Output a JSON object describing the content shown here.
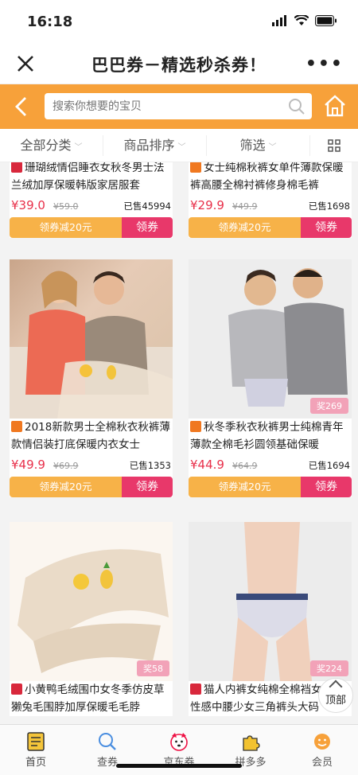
{
  "status_bar": {
    "time": "16:18"
  },
  "nav": {
    "title": "巴巴券－精选秒杀券！",
    "more": "•••"
  },
  "search": {
    "placeholder": "搜索你想要的宝贝"
  },
  "filters": [
    "全部分类",
    "商品排序",
    "筛选"
  ],
  "colors": {
    "brand_orange": "#f7a13a",
    "price_red": "#e8304a",
    "coupon_orange": "#f7b248",
    "get_pink": "#e8386a"
  },
  "products": [
    {
      "title": "珊瑚绒情侣睡衣女秋冬男士法兰绒加厚保暖韩版家居服套",
      "price": "¥39.0",
      "orig": "¥59.0",
      "sold": "已售45994",
      "coupon": "领券减20元",
      "get": "领券",
      "badge": ""
    },
    {
      "title": "女士纯棉秋裤女单件薄款保暖裤高腰全棉衬裤修身棉毛裤",
      "price": "¥29.9",
      "orig": "¥49.9",
      "sold": "已售1698",
      "coupon": "领券减20元",
      "get": "领券",
      "badge": ""
    },
    {
      "title": "2018新款男士全棉秋衣秋裤薄款情侣装打底保暖内衣女士",
      "price": "¥49.9",
      "orig": "¥69.9",
      "sold": "已售1353",
      "coupon": "领券减20元",
      "get": "领券",
      "badge": ""
    },
    {
      "title": "秋冬季秋衣秋裤男士纯棉青年薄款全棉毛衫圆领基础保暖",
      "price": "¥44.9",
      "orig": "¥64.9",
      "sold": "已售1694",
      "coupon": "领券减20元",
      "get": "领券",
      "badge": "奖269"
    },
    {
      "title": "小黄鸭毛绒围巾女冬季仿皮草獭兔毛围脖加厚保暖毛毛脖",
      "price": "",
      "orig": "",
      "sold": "",
      "coupon": "",
      "get": "",
      "badge": "奖58"
    },
    {
      "title": "猫人内裤女纯棉全棉裆女士边性感中腰少女三角裤头大码",
      "price": "",
      "orig": "",
      "sold": "",
      "coupon": "",
      "get": "",
      "badge": "奖224"
    }
  ],
  "back_to_top": "顶部",
  "tabbar": [
    {
      "label": "首页",
      "icon": "home-doc-icon"
    },
    {
      "label": "查券",
      "icon": "search-icon"
    },
    {
      "label": "京东券",
      "icon": "dog-icon"
    },
    {
      "label": "拼多多",
      "icon": "puzzle-icon"
    },
    {
      "label": "会员",
      "icon": "smile-icon"
    }
  ]
}
